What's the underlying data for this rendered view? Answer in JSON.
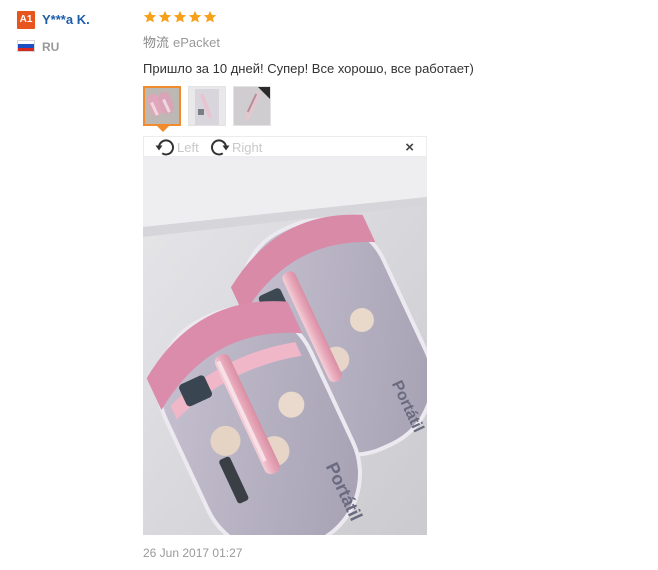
{
  "user": {
    "avatar": "A1",
    "name": "Y***a K.",
    "country": "RU"
  },
  "review": {
    "rating": 5,
    "rating_max": 5,
    "shipping_label": "物流",
    "shipping_method": "ePacket",
    "text": "Пришло за 10 дней! Супер! Все хорошо, все работает)",
    "date": "26 Jun 2017 01:27"
  },
  "viewer": {
    "rotate_left_label": "Left",
    "rotate_right_label": "Right",
    "close_label": "×",
    "selected_thumbnail": 1,
    "thumbnail_count": 3
  },
  "colors": {
    "accent": "#f08c2c",
    "star": "#f7a11a",
    "username": "#1d5ea8",
    "avatar_bg": "#e8541e"
  },
  "icons": [
    "rotate-left-icon",
    "rotate-right-icon",
    "close-icon",
    "star-icon",
    "russia-flag-icon"
  ]
}
